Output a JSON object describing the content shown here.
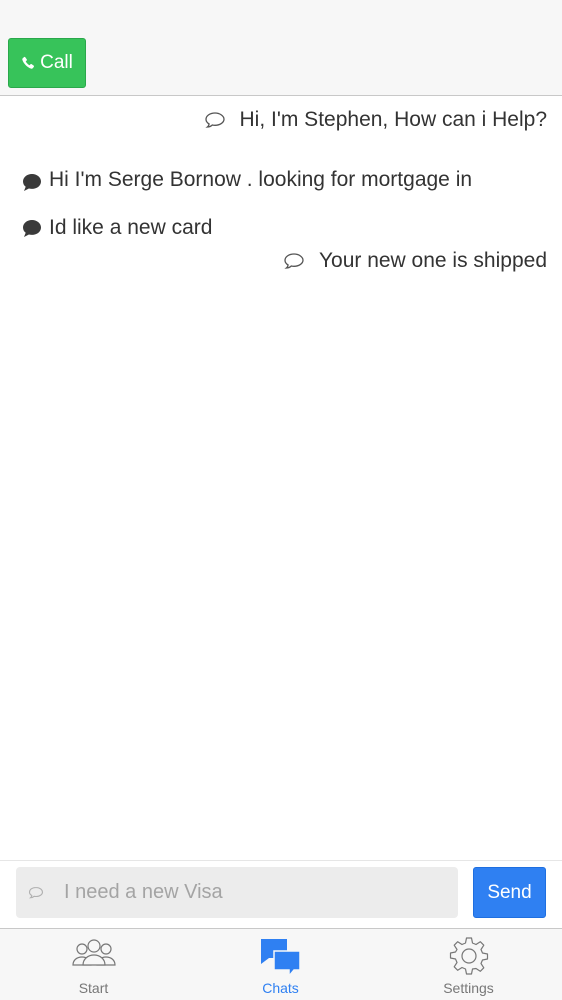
{
  "header": {
    "call_label": "Call"
  },
  "messages": [
    {
      "from": "agent",
      "text": "Hi, I'm Stephen, How can i Help?"
    },
    {
      "from": "user",
      "text": "Hi I'm Serge Bornow . looking for mortgage in"
    },
    {
      "from": "user",
      "text": "Id like a new card"
    },
    {
      "from": "agent",
      "text": "Your new one is shipped"
    }
  ],
  "composer": {
    "placeholder": "I need a new Visa",
    "send_label": "Send"
  },
  "tabs": [
    {
      "label": "Start",
      "icon": "group-icon"
    },
    {
      "label": "Chats",
      "icon": "chat-bubbles-icon",
      "active": true
    },
    {
      "label": "Settings",
      "icon": "gear-icon"
    }
  ],
  "colors": {
    "call": "#37c35a",
    "accent": "#2f80f2"
  }
}
